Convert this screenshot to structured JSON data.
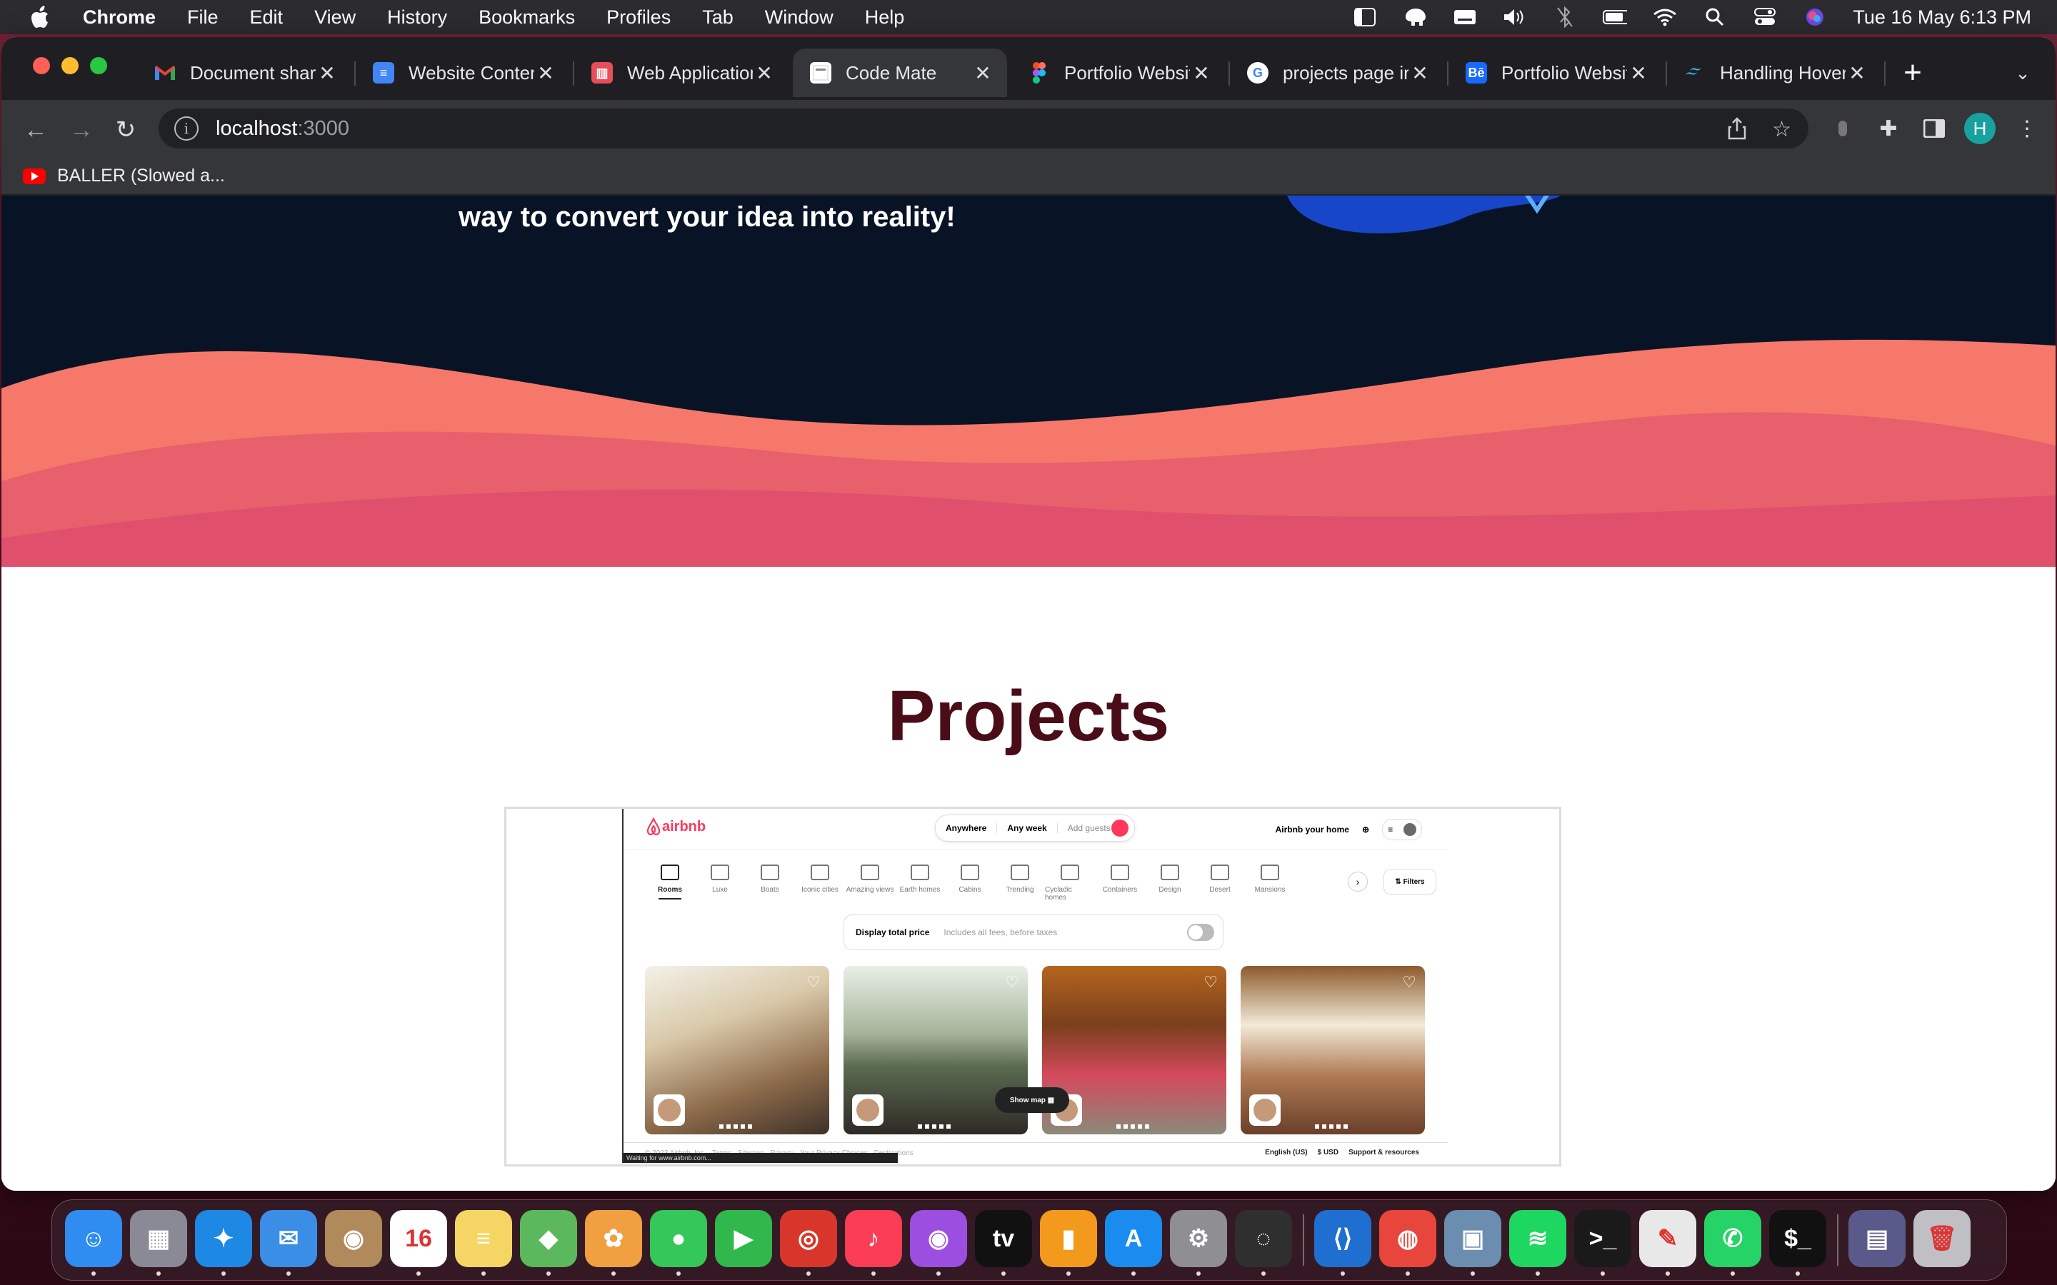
{
  "menubar": {
    "app": "Chrome",
    "items": [
      "File",
      "Edit",
      "View",
      "History",
      "Bookmarks",
      "Profiles",
      "Tab",
      "Window",
      "Help"
    ],
    "datetime": "Tue 16 May  6:13 PM"
  },
  "browser": {
    "tabs": [
      {
        "title": "Document shar",
        "icon": "gmail-icon",
        "color": "#ea4335"
      },
      {
        "title": "Website Conter",
        "icon": "google-docs-icon",
        "color": "#4285f4"
      },
      {
        "title": "Web Application",
        "icon": "trello-icon",
        "color": "#e84d5a"
      },
      {
        "title": "Code Mate",
        "icon": "page-icon",
        "color": "#ffffff",
        "active": true
      },
      {
        "title": "Portfolio Websit",
        "icon": "figma-icon",
        "color": "#a259ff"
      },
      {
        "title": "projects page ir",
        "icon": "google-icon",
        "color": "#4285f4"
      },
      {
        "title": "Portfolio Websit",
        "icon": "behance-icon",
        "color": "#1769ff"
      },
      {
        "title": "Handling Hover",
        "icon": "tailwind-icon",
        "color": "#38bdf8"
      }
    ],
    "url_host": "localhost",
    "url_port": ":3000",
    "profile_initial": "H",
    "bookmark": "BALLER (Slowed a..."
  },
  "page": {
    "hero_text": "way to convert your idea into reality!",
    "projects_title": "Projects",
    "colors": {
      "hero_bg": "#081426",
      "wave_light": "#f6786a",
      "wave_dark": "#e04f6c",
      "title": "#4a0d18"
    }
  },
  "airbnb": {
    "logo": "airbnb",
    "search": {
      "where": "Anywhere",
      "when": "Any week",
      "guests": "Add guests"
    },
    "host_link": "Airbnb your home",
    "categories": [
      "Rooms",
      "Luxe",
      "Boats",
      "Iconic cities",
      "Amazing views",
      "Earth homes",
      "Cabins",
      "Trending",
      "Cycladic homes",
      "Containers",
      "Design",
      "Desert",
      "Mansions"
    ],
    "filters": "Filters",
    "price_toggle": {
      "label": "Display total price",
      "sub": "Includes all fees, before taxes"
    },
    "show_map": "Show map",
    "footer_left": "© 2023 Airbnb, Inc. · Terms · Sitemap · Privacy · Your Privacy Choices · Destinations",
    "footer_right": {
      "language": "English (US)",
      "currency": "$ USD",
      "support": "Support & resources"
    },
    "status": "Waiting for www.airbnb.com..."
  },
  "dock": {
    "apps": [
      {
        "name": "finder-icon",
        "color": "#2f8cf0",
        "glyph": "☺"
      },
      {
        "name": "launchpad-icon",
        "color": "#8a8a96",
        "glyph": "▦"
      },
      {
        "name": "safari-icon",
        "color": "#1e88e5",
        "glyph": "✦"
      },
      {
        "name": "mail-icon",
        "color": "#3a8ee6",
        "glyph": "✉"
      },
      {
        "name": "contacts-icon",
        "color": "#b08a5a",
        "glyph": "◉"
      },
      {
        "name": "calendar-icon",
        "color": "#ffffff",
        "glyph": "16"
      },
      {
        "name": "notes-icon",
        "color": "#f5d664",
        "glyph": "≡"
      },
      {
        "name": "maps-icon",
        "color": "#5cb85c",
        "glyph": "◆"
      },
      {
        "name": "photos-icon",
        "color": "#f0a040",
        "glyph": "✿"
      },
      {
        "name": "messages-icon",
        "color": "#34c759",
        "glyph": "●"
      },
      {
        "name": "facetime-icon",
        "color": "#30b84c",
        "glyph": "▶"
      },
      {
        "name": "photo-booth-icon",
        "color": "#d9362b",
        "glyph": "◎"
      },
      {
        "name": "music-icon",
        "color": "#fa3c55",
        "glyph": "♪"
      },
      {
        "name": "podcasts-icon",
        "color": "#9b4ee0",
        "glyph": "◉"
      },
      {
        "name": "tv-icon",
        "color": "#111111",
        "glyph": "tv"
      },
      {
        "name": "books-icon",
        "color": "#f39a1c",
        "glyph": "▮"
      },
      {
        "name": "app-store-icon",
        "color": "#1a8cf0",
        "glyph": "A"
      },
      {
        "name": "system-settings-icon",
        "color": "#8e8e93",
        "glyph": "⚙"
      },
      {
        "name": "activity-icon",
        "color": "#2f2f2f",
        "glyph": "◌"
      },
      {
        "name": "vscode-icon",
        "color": "#1e6fd0",
        "glyph": "⟨⟩"
      },
      {
        "name": "chrome-icon",
        "color": "#e8453c",
        "glyph": "◍"
      },
      {
        "name": "preview-icon",
        "color": "#6a8db0",
        "glyph": "▣"
      },
      {
        "name": "spotify-icon",
        "color": "#1ed760",
        "glyph": "≋"
      },
      {
        "name": "terminal-icon",
        "color": "#1a1a1a",
        "glyph": ">_"
      },
      {
        "name": "textedit-icon",
        "color": "#e8e8e8",
        "glyph": "✎"
      },
      {
        "name": "whatsapp-icon",
        "color": "#25d366",
        "glyph": "✆"
      },
      {
        "name": "iterm-icon",
        "color": "#111111",
        "glyph": "$_"
      },
      {
        "name": "downloads-stack-icon",
        "color": "#5a5a8a",
        "glyph": "▤"
      },
      {
        "name": "trash-icon",
        "color": "#bfbfc4",
        "glyph": "🗑"
      }
    ]
  }
}
